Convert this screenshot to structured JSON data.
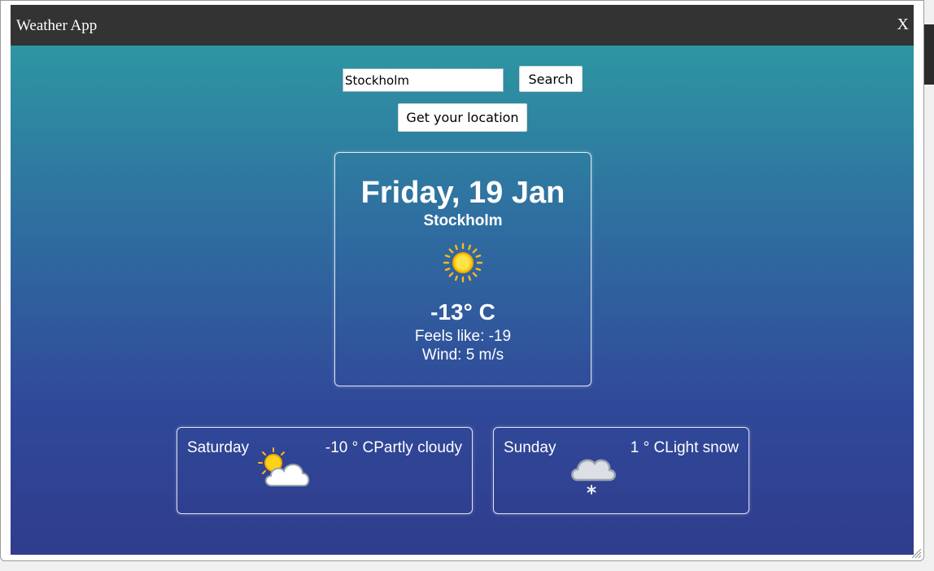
{
  "window": {
    "title": "Weather App",
    "close_label": "X"
  },
  "search": {
    "value": "Stockholm",
    "button_label": "Search"
  },
  "location_button_label": "Get your location",
  "current": {
    "date": "Friday, 19 Jan",
    "city": "Stockholm",
    "icon": "sun-icon",
    "temperature": "-13° C",
    "feels_like": "Feels like: -19",
    "wind": "Wind: 5 m/s"
  },
  "forecast": [
    {
      "day": "Saturday",
      "icon": "partly-cloudy-icon",
      "summary": "-10 ° CPartly cloudy"
    },
    {
      "day": "Sunday",
      "icon": "light-snow-icon",
      "summary": "1 ° CLight snow"
    }
  ],
  "colors": {
    "titlebar": "#333333",
    "gradient_top": "#2d96a2",
    "gradient_bottom": "#303c8c",
    "text": "#ffffff",
    "sun": "#ffd21a"
  }
}
